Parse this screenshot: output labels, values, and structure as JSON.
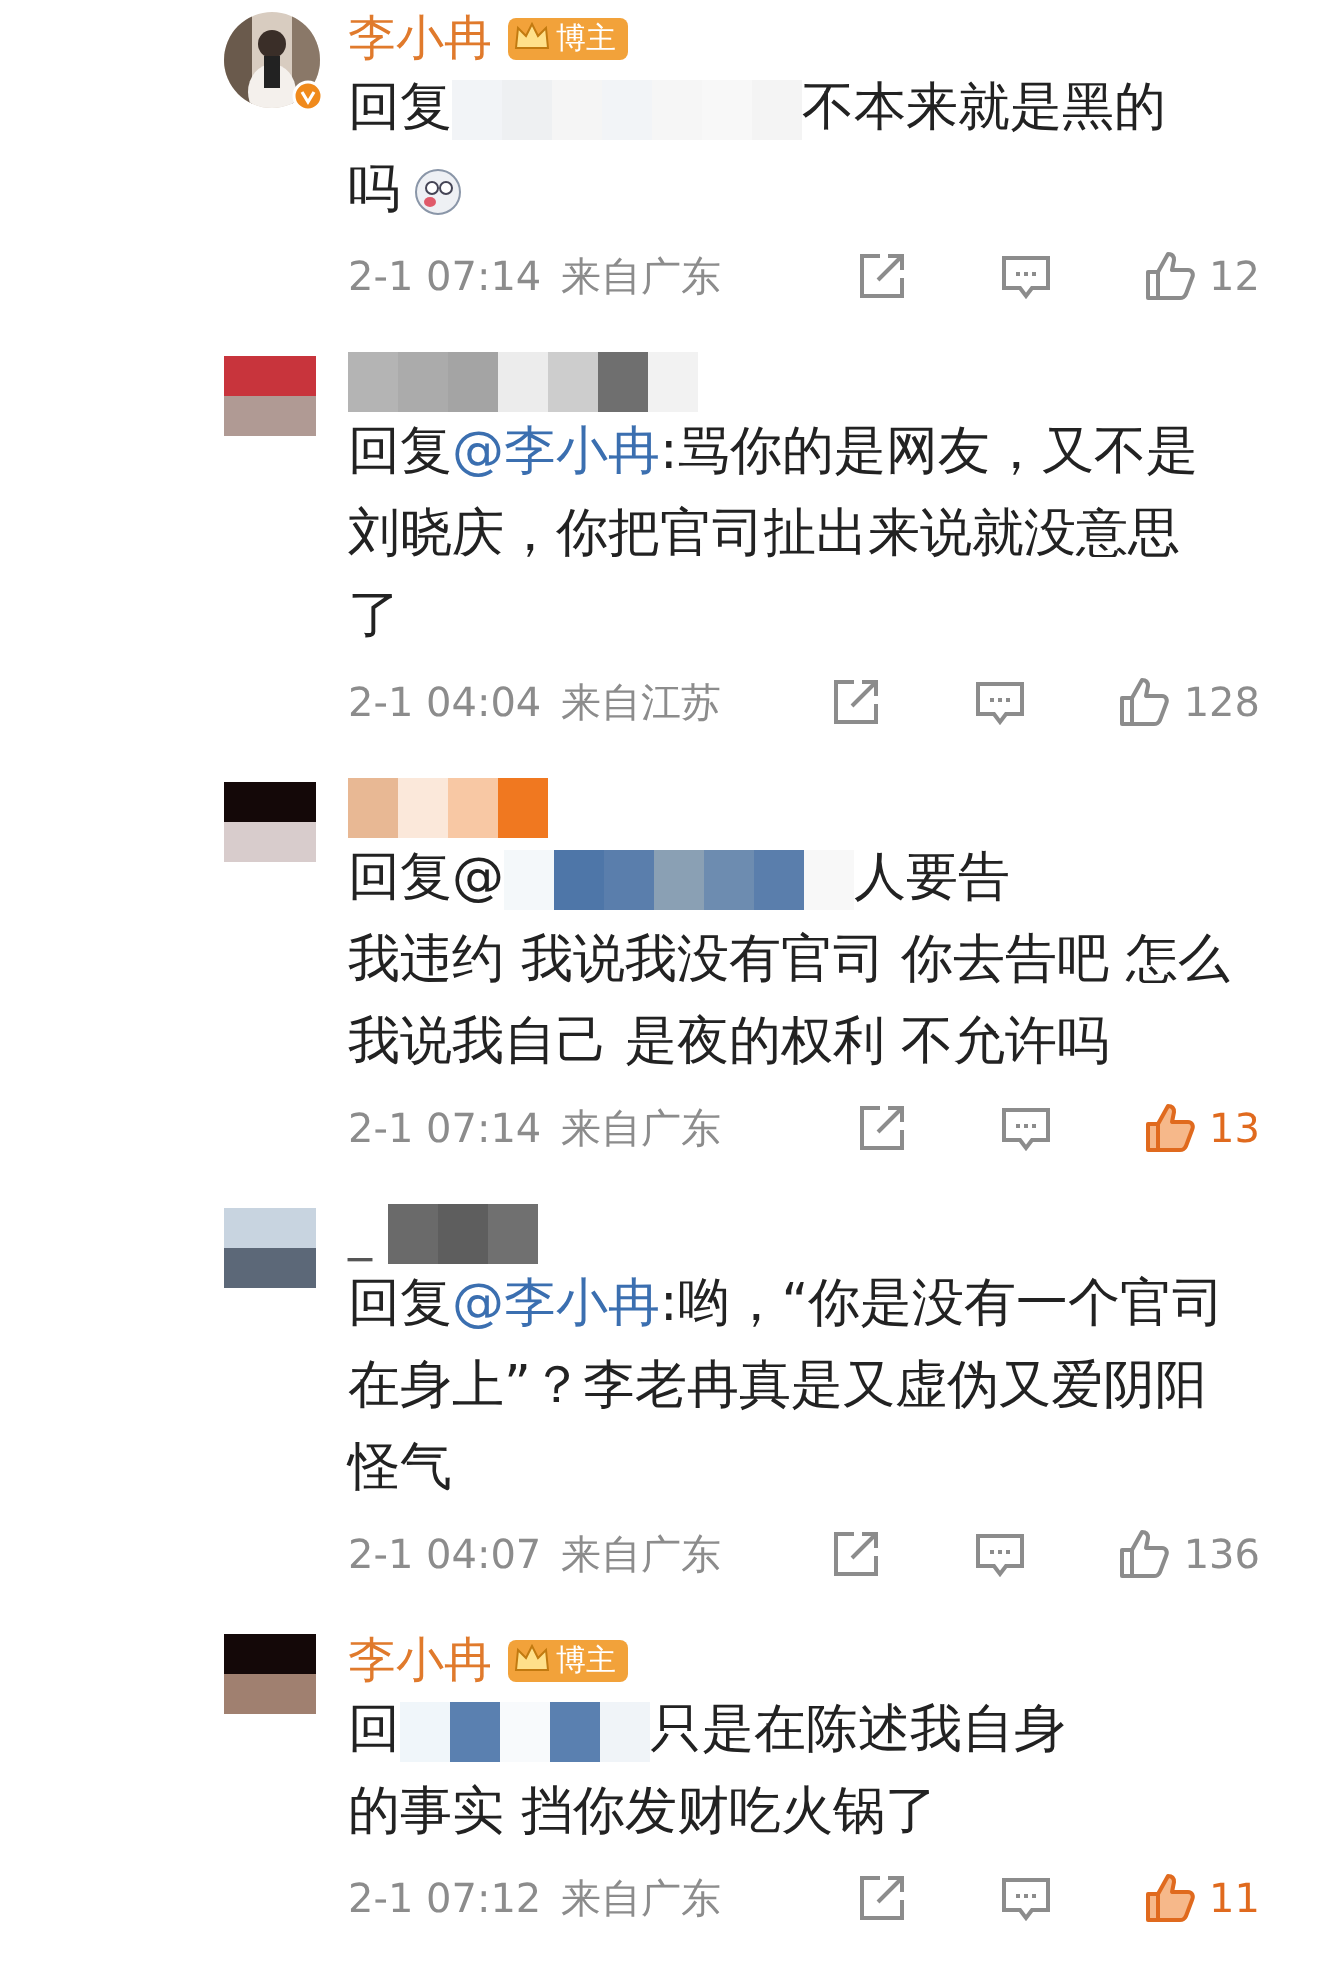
{
  "comments": [
    {
      "author": {
        "name": "李小冉",
        "masked": false
      },
      "badge": "博主",
      "reply": {
        "prefix": "回复",
        "masked": true,
        "lines": [
          "不本来就是黑的",
          "吗"
        ],
        "emoji": true
      },
      "time": "2-1 07:14",
      "location": "来自广东",
      "likes": "12",
      "liked": false
    },
    {
      "avatar": {
        "kind": "blurred"
      },
      "author": {
        "masked": true
      },
      "reply": {
        "prefix": "回复",
        "mention": "@李小冉",
        "masked": false,
        "lines": [
          ":骂你的是网友，又不是",
          "刘晓庆，你把官司扯出来说就没意思",
          "了"
        ],
        "emoji": false
      },
      "time": "2-1 04:04",
      "location": "来自江苏",
      "likes": "128",
      "liked": false
    },
    {
      "avatar": {
        "kind": "blurred"
      },
      "author": {
        "masked": true
      },
      "reply": {
        "prefix": "回复@",
        "masked": true,
        "lines": [
          "人要告",
          "我违约 我说我没有官司 你去告吧 怎么",
          "我说我自己 是夜的权利 不允许吗"
        ],
        "emoji": false
      },
      "time": "2-1 07:14",
      "location": "来自广东",
      "likes": "13",
      "liked": true
    },
    {
      "avatar": {
        "kind": "blurred"
      },
      "author": {
        "name": "_",
        "masked": true
      },
      "reply": {
        "prefix": "回复",
        "mention": "@李小冉",
        "masked": false,
        "lines": [
          ":哟，“你是没有一个官司",
          "在身上”？李老冉真是又虚伪又爱阴阳",
          "怪气"
        ],
        "emoji": false
      },
      "time": "2-1 04:07",
      "location": "来自广东",
      "likes": "136",
      "liked": false
    },
    {
      "avatar": {
        "kind": "blurred"
      },
      "author": {
        "name": "李小冉",
        "masked": false
      },
      "badge": "博主",
      "reply": {
        "prefix": "回",
        "masked": true,
        "lines": [
          "只是在陈述我自身",
          "的事实 挡你发财吃火锅了"
        ],
        "emoji": false
      },
      "time": "2-1 07:12",
      "location": "来自广东",
      "likes": "11",
      "liked": true
    }
  ]
}
